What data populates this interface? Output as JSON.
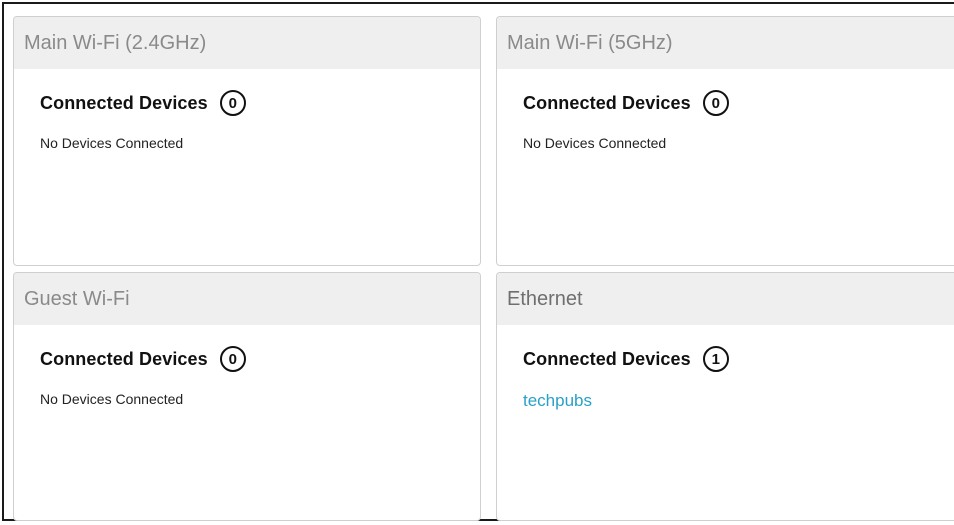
{
  "panels": {
    "main_24": {
      "title": "Main Wi-Fi (2.4GHz)",
      "connected_label": "Connected Devices",
      "count": "0",
      "status": "No Devices Connected"
    },
    "main_5": {
      "title": "Main Wi-Fi (5GHz)",
      "connected_label": "Connected Devices",
      "count": "0",
      "status": "No Devices Connected"
    },
    "guest": {
      "title": "Guest Wi-Fi",
      "connected_label": "Connected Devices",
      "count": "0",
      "status": "No Devices Connected"
    },
    "ethernet": {
      "title": "Ethernet",
      "connected_label": "Connected Devices",
      "count": "1",
      "devices": [
        "techpubs"
      ]
    }
  },
  "colors": {
    "header_bg": "#efefef",
    "header_text": "#8a8a8a",
    "link": "#2aa0c8",
    "panel_border": "#cfcfcf"
  }
}
